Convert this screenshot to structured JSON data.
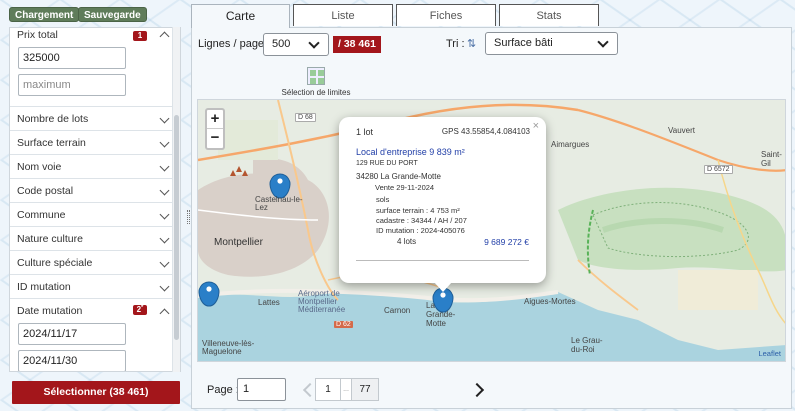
{
  "toolbar": {
    "load_label": "Chargement",
    "save_label": "Sauvegarde"
  },
  "tabs": [
    {
      "label": "Carte",
      "active": true
    },
    {
      "label": "Liste",
      "active": false
    },
    {
      "label": "Fiches",
      "active": false
    },
    {
      "label": "Stats",
      "active": false
    }
  ],
  "filters": {
    "prix_total": {
      "label": "Prix total",
      "badge": "1",
      "min_value": "325000",
      "max_placeholder": "maximum"
    },
    "collapsed": [
      {
        "label": "Nombre de lots"
      },
      {
        "label": "Surface terrain"
      },
      {
        "label": "Nom voie"
      },
      {
        "label": "Code postal"
      },
      {
        "label": "Commune"
      },
      {
        "label": "Nature culture"
      },
      {
        "label": "Culture spéciale"
      },
      {
        "label": "ID mutation"
      }
    ],
    "date_mutation": {
      "label": "Date mutation",
      "badge": "2",
      "badge_sup": "*",
      "from": "2024/11/17",
      "to": "2024/11/30"
    }
  },
  "select_button_label": "Sélectionner (38 461)",
  "controls": {
    "lines_label": "Lignes / page :",
    "lines_value": "500",
    "count": "/ 38 461",
    "sort_label": "Tri :",
    "sort_value": "Surface bâti",
    "limits_label": "Sélection de limites"
  },
  "map": {
    "zoom_in": "+",
    "zoom_out": "−",
    "labels": {
      "castelnau": "Castelnau-le-Lez",
      "montpellier": "Montpellier",
      "lattes": "Lattes",
      "aeroport": "Aéroport de Montpellier Méditerranée",
      "villeneuve": "Villeneuve-lès-Maguelone",
      "la_grande_motte": "La Grande-Motte",
      "aigues_mortes": "Aigues-Mortes",
      "le_grau_du_roi": "Le Grau-du-Roi",
      "vauvert": "Vauvert",
      "saint_gilles": "Saint-Gil",
      "aimargues": "Aimargues",
      "carnon": "Carnon"
    },
    "roads": {
      "d68": "D 68",
      "d6572": "D 6572",
      "d62": "D 62"
    },
    "attribution": "Leaflet"
  },
  "popup": {
    "lots_header": "1 lot",
    "gps": "GPS 43.55854,4.084103",
    "close": "×",
    "title": "Local d'entreprise 9 839 m²",
    "address_line1": "129 RUE DU PORT",
    "address_line2": "34280 La Grande-Motte",
    "vente": "Vente 29-11-2024",
    "sols": "sols",
    "surface_terrain": "surface terrain : 4 753 m²",
    "cadastre": "cadastre : 34344 / AH / 207",
    "id_mutation": "ID mutation : 2024-405076",
    "lots": "4 lots",
    "price": "9 689 272 €"
  },
  "pagination": {
    "page_label": "Page :",
    "page_value": "1",
    "current": "1",
    "ellipsis": "...",
    "last": "77"
  },
  "colors": {
    "accent_red": "#a3161b",
    "button_green": "#5f7c5a",
    "link_blue": "#2340a8",
    "marker_blue": "#2a7fc8"
  }
}
